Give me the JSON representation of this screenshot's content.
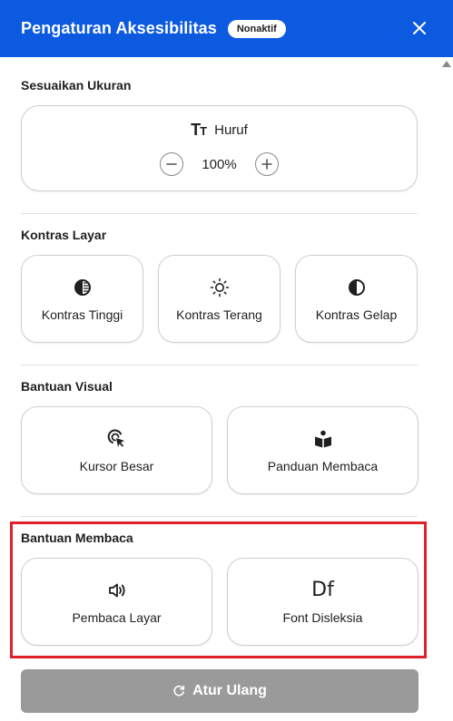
{
  "header": {
    "title": "Pengaturan Aksesibilitas",
    "status_badge": "Nonaktif",
    "close_icon": "close-icon"
  },
  "size_section": {
    "label": "Sesuaikan Ukuran",
    "font_icon": "text-size-icon",
    "font_label": "Huruf",
    "font_icon_glyph_big": "T",
    "font_icon_glyph_small": "T",
    "zoom_value": "100%",
    "decrease_icon": "minus-circle-icon",
    "increase_icon": "plus-circle-icon"
  },
  "contrast_section": {
    "label": "Kontras Layar",
    "options": [
      {
        "label": "Kontras Tinggi",
        "icon": "high-contrast-icon"
      },
      {
        "label": "Kontras Terang",
        "icon": "sun-icon"
      },
      {
        "label": "Kontras Gelap",
        "icon": "dark-contrast-icon"
      }
    ]
  },
  "visual_section": {
    "label": "Bantuan Visual",
    "options": [
      {
        "label": "Kursor Besar",
        "icon": "cursor-icon"
      },
      {
        "label": "Panduan Membaca",
        "icon": "reading-guide-icon"
      }
    ]
  },
  "reading_section": {
    "label": "Bantuan Membaca",
    "options": [
      {
        "label": "Pembaca Layar",
        "icon": "speaker-icon"
      },
      {
        "label": "Font Disleksia",
        "icon": "dyslexia-font-icon",
        "glyph": "Df"
      }
    ]
  },
  "reset": {
    "label": "Atur Ulang",
    "icon": "reset-icon"
  },
  "colors": {
    "header_bg": "#0c5ae0",
    "highlight_border": "#e0202a",
    "reset_bg": "#9a9a9a"
  }
}
